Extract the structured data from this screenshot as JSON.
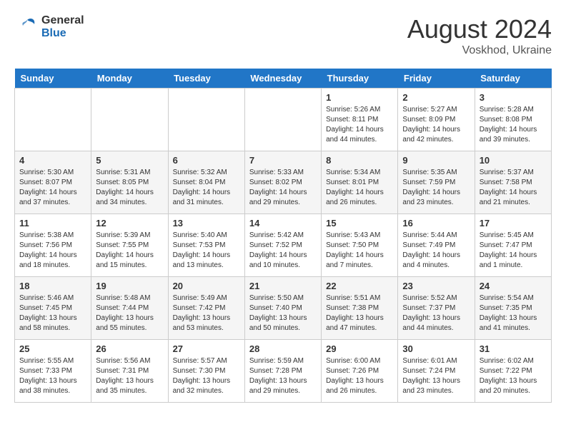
{
  "header": {
    "logo_general": "General",
    "logo_blue": "Blue",
    "month_year": "August 2024",
    "location": "Voskhod, Ukraine"
  },
  "days_of_week": [
    "Sunday",
    "Monday",
    "Tuesday",
    "Wednesday",
    "Thursday",
    "Friday",
    "Saturday"
  ],
  "weeks": [
    [
      {
        "day": "",
        "info": ""
      },
      {
        "day": "",
        "info": ""
      },
      {
        "day": "",
        "info": ""
      },
      {
        "day": "",
        "info": ""
      },
      {
        "day": "1",
        "info": "Sunrise: 5:26 AM\nSunset: 8:11 PM\nDaylight: 14 hours\nand 44 minutes."
      },
      {
        "day": "2",
        "info": "Sunrise: 5:27 AM\nSunset: 8:09 PM\nDaylight: 14 hours\nand 42 minutes."
      },
      {
        "day": "3",
        "info": "Sunrise: 5:28 AM\nSunset: 8:08 PM\nDaylight: 14 hours\nand 39 minutes."
      }
    ],
    [
      {
        "day": "4",
        "info": "Sunrise: 5:30 AM\nSunset: 8:07 PM\nDaylight: 14 hours\nand 37 minutes."
      },
      {
        "day": "5",
        "info": "Sunrise: 5:31 AM\nSunset: 8:05 PM\nDaylight: 14 hours\nand 34 minutes."
      },
      {
        "day": "6",
        "info": "Sunrise: 5:32 AM\nSunset: 8:04 PM\nDaylight: 14 hours\nand 31 minutes."
      },
      {
        "day": "7",
        "info": "Sunrise: 5:33 AM\nSunset: 8:02 PM\nDaylight: 14 hours\nand 29 minutes."
      },
      {
        "day": "8",
        "info": "Sunrise: 5:34 AM\nSunset: 8:01 PM\nDaylight: 14 hours\nand 26 minutes."
      },
      {
        "day": "9",
        "info": "Sunrise: 5:35 AM\nSunset: 7:59 PM\nDaylight: 14 hours\nand 23 minutes."
      },
      {
        "day": "10",
        "info": "Sunrise: 5:37 AM\nSunset: 7:58 PM\nDaylight: 14 hours\nand 21 minutes."
      }
    ],
    [
      {
        "day": "11",
        "info": "Sunrise: 5:38 AM\nSunset: 7:56 PM\nDaylight: 14 hours\nand 18 minutes."
      },
      {
        "day": "12",
        "info": "Sunrise: 5:39 AM\nSunset: 7:55 PM\nDaylight: 14 hours\nand 15 minutes."
      },
      {
        "day": "13",
        "info": "Sunrise: 5:40 AM\nSunset: 7:53 PM\nDaylight: 14 hours\nand 13 minutes."
      },
      {
        "day": "14",
        "info": "Sunrise: 5:42 AM\nSunset: 7:52 PM\nDaylight: 14 hours\nand 10 minutes."
      },
      {
        "day": "15",
        "info": "Sunrise: 5:43 AM\nSunset: 7:50 PM\nDaylight: 14 hours\nand 7 minutes."
      },
      {
        "day": "16",
        "info": "Sunrise: 5:44 AM\nSunset: 7:49 PM\nDaylight: 14 hours\nand 4 minutes."
      },
      {
        "day": "17",
        "info": "Sunrise: 5:45 AM\nSunset: 7:47 PM\nDaylight: 14 hours\nand 1 minute."
      }
    ],
    [
      {
        "day": "18",
        "info": "Sunrise: 5:46 AM\nSunset: 7:45 PM\nDaylight: 13 hours\nand 58 minutes."
      },
      {
        "day": "19",
        "info": "Sunrise: 5:48 AM\nSunset: 7:44 PM\nDaylight: 13 hours\nand 55 minutes."
      },
      {
        "day": "20",
        "info": "Sunrise: 5:49 AM\nSunset: 7:42 PM\nDaylight: 13 hours\nand 53 minutes."
      },
      {
        "day": "21",
        "info": "Sunrise: 5:50 AM\nSunset: 7:40 PM\nDaylight: 13 hours\nand 50 minutes."
      },
      {
        "day": "22",
        "info": "Sunrise: 5:51 AM\nSunset: 7:38 PM\nDaylight: 13 hours\nand 47 minutes."
      },
      {
        "day": "23",
        "info": "Sunrise: 5:52 AM\nSunset: 7:37 PM\nDaylight: 13 hours\nand 44 minutes."
      },
      {
        "day": "24",
        "info": "Sunrise: 5:54 AM\nSunset: 7:35 PM\nDaylight: 13 hours\nand 41 minutes."
      }
    ],
    [
      {
        "day": "25",
        "info": "Sunrise: 5:55 AM\nSunset: 7:33 PM\nDaylight: 13 hours\nand 38 minutes."
      },
      {
        "day": "26",
        "info": "Sunrise: 5:56 AM\nSunset: 7:31 PM\nDaylight: 13 hours\nand 35 minutes."
      },
      {
        "day": "27",
        "info": "Sunrise: 5:57 AM\nSunset: 7:30 PM\nDaylight: 13 hours\nand 32 minutes."
      },
      {
        "day": "28",
        "info": "Sunrise: 5:59 AM\nSunset: 7:28 PM\nDaylight: 13 hours\nand 29 minutes."
      },
      {
        "day": "29",
        "info": "Sunrise: 6:00 AM\nSunset: 7:26 PM\nDaylight: 13 hours\nand 26 minutes."
      },
      {
        "day": "30",
        "info": "Sunrise: 6:01 AM\nSunset: 7:24 PM\nDaylight: 13 hours\nand 23 minutes."
      },
      {
        "day": "31",
        "info": "Sunrise: 6:02 AM\nSunset: 7:22 PM\nDaylight: 13 hours\nand 20 minutes."
      }
    ]
  ]
}
